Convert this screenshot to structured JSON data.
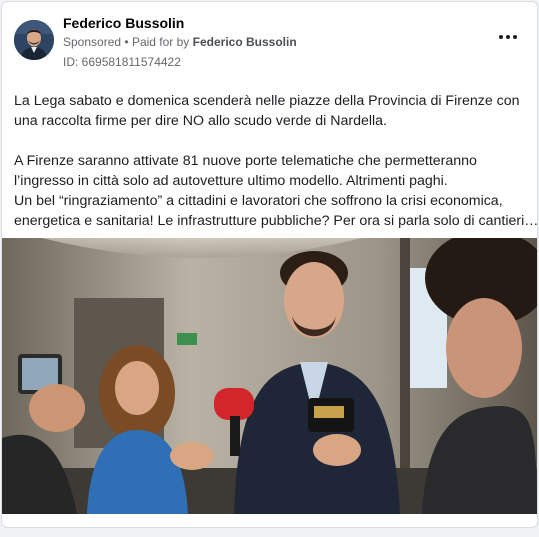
{
  "post": {
    "author": "Federico Bussolin",
    "sponsored": "Sponsored",
    "separator": "•",
    "paid_for_prefix": "Paid for by",
    "paid_for_name": "Federico Bussolin",
    "ad_id": "ID: 669581811574422",
    "paragraphs": [
      "La Lega sabato e domenica scenderà nelle piazze della Provincia di Firenze con",
      "una raccolta firme per dire NO allo scudo verde di Nardella.",
      "",
      "A Firenze saranno attivate 81 nuove porte telematiche che permetteranno",
      "l’ingresso in città solo ad autovetture ultimo modello. Altrimenti paghi.",
      "Un bel “ringraziamento” a cittadini e lavoratori che soffrono la crisi economica,",
      "energetica e sanitaria! Le infrastrutture pubbliche? Per ora si parla solo di cantieri…"
    ]
  },
  "icons": {
    "more": "more-options-icon",
    "avatar": "profile-avatar"
  },
  "colors": {
    "card_bg": "#ffffff",
    "page_bg": "#f0f2f5",
    "muted_text": "#65676b",
    "primary_text": "#1c1e21"
  }
}
